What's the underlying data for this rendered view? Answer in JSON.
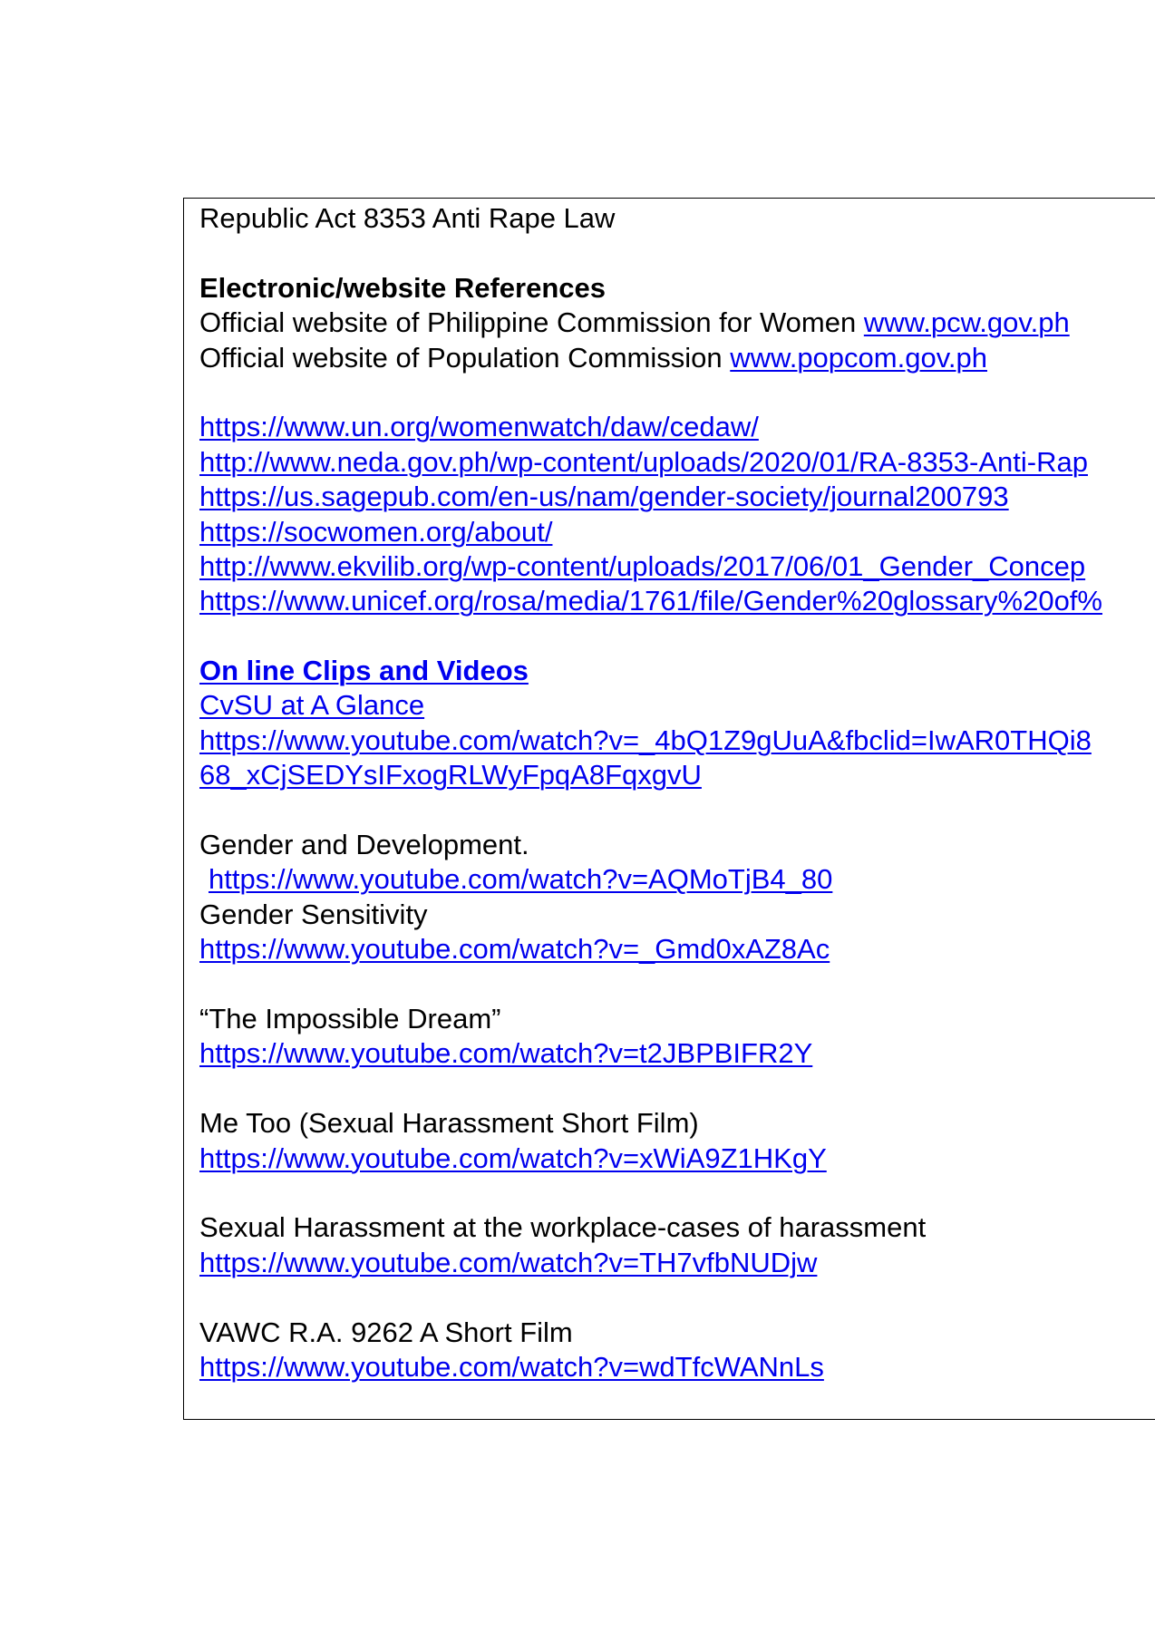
{
  "law_reference": "Republic Act 8353 Anti Rape Law",
  "electronic_refs": {
    "heading": "Electronic/website References",
    "items": [
      {
        "text": "Official website of Philippine Commission for Women ",
        "link": "www.pcw.gov.ph"
      },
      {
        "text": "Official website of Population Commission ",
        "link": "www.popcom.gov.ph"
      }
    ],
    "urls": [
      "https://www.un.org/womenwatch/daw/cedaw/",
      "http://www.neda.gov.ph/wp-content/uploads/2020/01/RA-8353-Anti-Rap",
      "https://us.sagepub.com/en-us/nam/gender-society/journal200793",
      "https://socwomen.org/about/",
      "http://www.ekvilib.org/wp-content/uploads/2017/06/01_Gender_Concep",
      "https://www.unicef.org/rosa/media/1761/file/Gender%20glossary%20of%"
    ]
  },
  "videos": {
    "heading": "On line Clips and Videos",
    "cvsu_title": "CvSU at A Glance",
    "cvsu_url_line1": "https://www.youtube.com/watch?v=_4bQ1Z9gUuA&fbclid=IwAR0THQi8",
    "cvsu_url_line2": "68_xCjSEDYsIFxogRLWyFpqA8FqxgvU",
    "gad_title": "Gender and Development.",
    "gad_url": "https://www.youtube.com/watch?v=AQMoTjB4_80",
    "sensitivity_title": "Gender Sensitivity",
    "sensitivity_url": "https://www.youtube.com/watch?v=_Gmd0xAZ8Ac",
    "dream_title": "“The Impossible Dream”",
    "dream_url": "https://www.youtube.com/watch?v=t2JBPBIFR2Y",
    "metoo_title": "Me Too (Sexual Harassment Short Film)",
    "metoo_url": "https://www.youtube.com/watch?v=xWiA9Z1HKgY",
    "workplace_title": "Sexual Harassment at the workplace-cases of harassment",
    "workplace_url": "https://www.youtube.com/watch?v=TH7vfbNUDjw",
    "vawc_title": "VAWC R.A. 9262 A Short Film",
    "vawc_url": "https://www.youtube.com/watch?v=wdTfcWANnLs"
  },
  "colors": {
    "link": "#0000ee",
    "text": "#000000",
    "border": "#000000"
  }
}
